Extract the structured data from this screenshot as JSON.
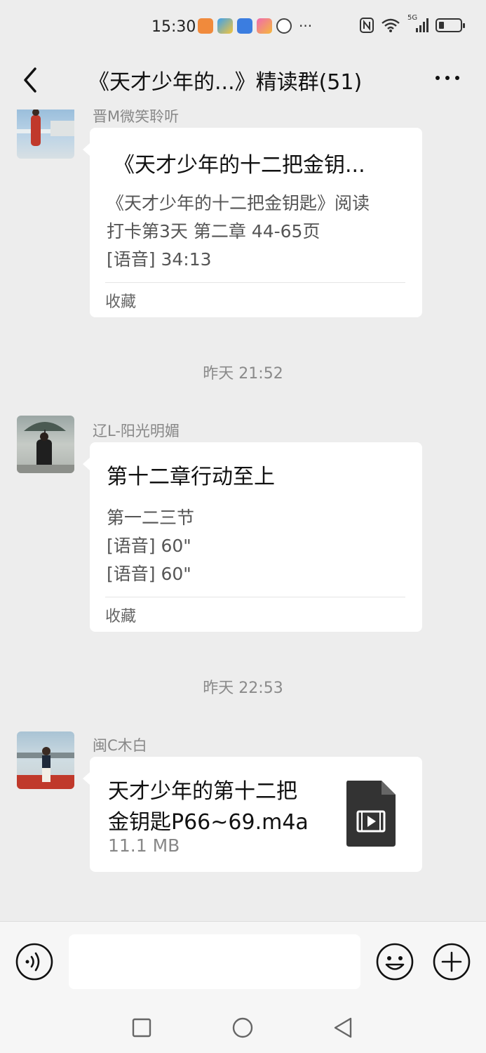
{
  "status_bar": {
    "time": "15:30",
    "network_label": "5G",
    "icons": [
      "notification-app-icon",
      "nfc-icon",
      "wifi-icon",
      "signal-icon",
      "battery-icon"
    ],
    "overflow": "···"
  },
  "header": {
    "title": "《天才少年的...》精读群(51)",
    "back_icon": "chevron-left-icon",
    "more_icon": "more-dots-icon"
  },
  "messages": [
    {
      "sender": "晋M微笑聆听",
      "type": "favorite-card",
      "title": "《天才少年的十二把金钥...",
      "lines": [
        "《天才少年的十二把金钥匙》阅读",
        "打卡第3天 第二章   44-65页",
        "[语音] 34:13"
      ],
      "footer": "收藏"
    },
    {
      "timestamp": "昨天 21:52"
    },
    {
      "sender": "辽L-阳光明媚",
      "type": "favorite-card",
      "title": "第十二章行动至上",
      "lines": [
        "第一二三节",
        "[语音] 60\"",
        "[语音] 60\""
      ],
      "footer": "收藏"
    },
    {
      "timestamp": "昨天 22:53"
    },
    {
      "sender": "闽C木白",
      "type": "file",
      "file_name_line1": "天才少年的第十二把",
      "file_name_line2": "金钥匙P66~69.m4a",
      "file_size": "11.1 MB",
      "icon": "video-file-icon"
    }
  ],
  "input_bar": {
    "placeholder": "",
    "value": ""
  },
  "colors": {
    "background": "#ededed",
    "bubble": "#ffffff",
    "meta_text": "#888888"
  }
}
